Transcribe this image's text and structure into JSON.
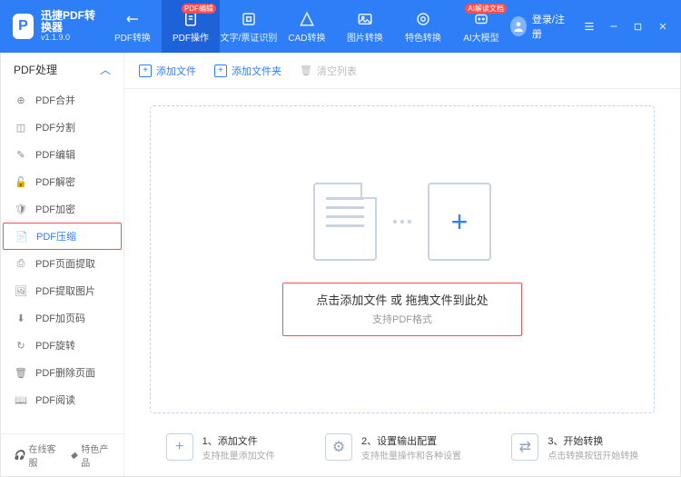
{
  "app": {
    "name": "迅捷PDF转换器",
    "version": "v1.1.9.0"
  },
  "tabs": [
    {
      "label": "PDF转换",
      "badge": ""
    },
    {
      "label": "PDF操作",
      "badge": "PDF编辑"
    },
    {
      "label": "文字/票证识别",
      "badge": ""
    },
    {
      "label": "CAD转换",
      "badge": ""
    },
    {
      "label": "图片转换",
      "badge": ""
    },
    {
      "label": "特色转换",
      "badge": ""
    },
    {
      "label": "AI大模型",
      "badge": "AI解读文档"
    }
  ],
  "auth": {
    "label": "登录/注册"
  },
  "sidebar": {
    "header": "PDF处理",
    "items": [
      {
        "label": "PDF合并"
      },
      {
        "label": "PDF分割"
      },
      {
        "label": "PDF编辑"
      },
      {
        "label": "PDF解密"
      },
      {
        "label": "PDF加密"
      },
      {
        "label": "PDF压缩"
      },
      {
        "label": "PDF页面提取"
      },
      {
        "label": "PDF提取图片"
      },
      {
        "label": "PDF加页码"
      },
      {
        "label": "PDF旋转"
      },
      {
        "label": "PDF删除页面"
      },
      {
        "label": "PDF阅读"
      }
    ],
    "footer": {
      "support": "在线客服",
      "featured": "特色产品"
    }
  },
  "toolbar": {
    "add_file": "添加文件",
    "add_folder": "添加文件夹",
    "clear_list": "清空列表"
  },
  "drop": {
    "main": "点击添加文件 或 拖拽文件到此处",
    "sub": "支持PDF格式"
  },
  "steps": [
    {
      "title": "1、添加文件",
      "sub": "支持批量添加文件"
    },
    {
      "title": "2、设置输出配置",
      "sub": "支持批量操作和各种设置"
    },
    {
      "title": "3、开始转换",
      "sub": "点击转换按钮开始转换"
    }
  ]
}
